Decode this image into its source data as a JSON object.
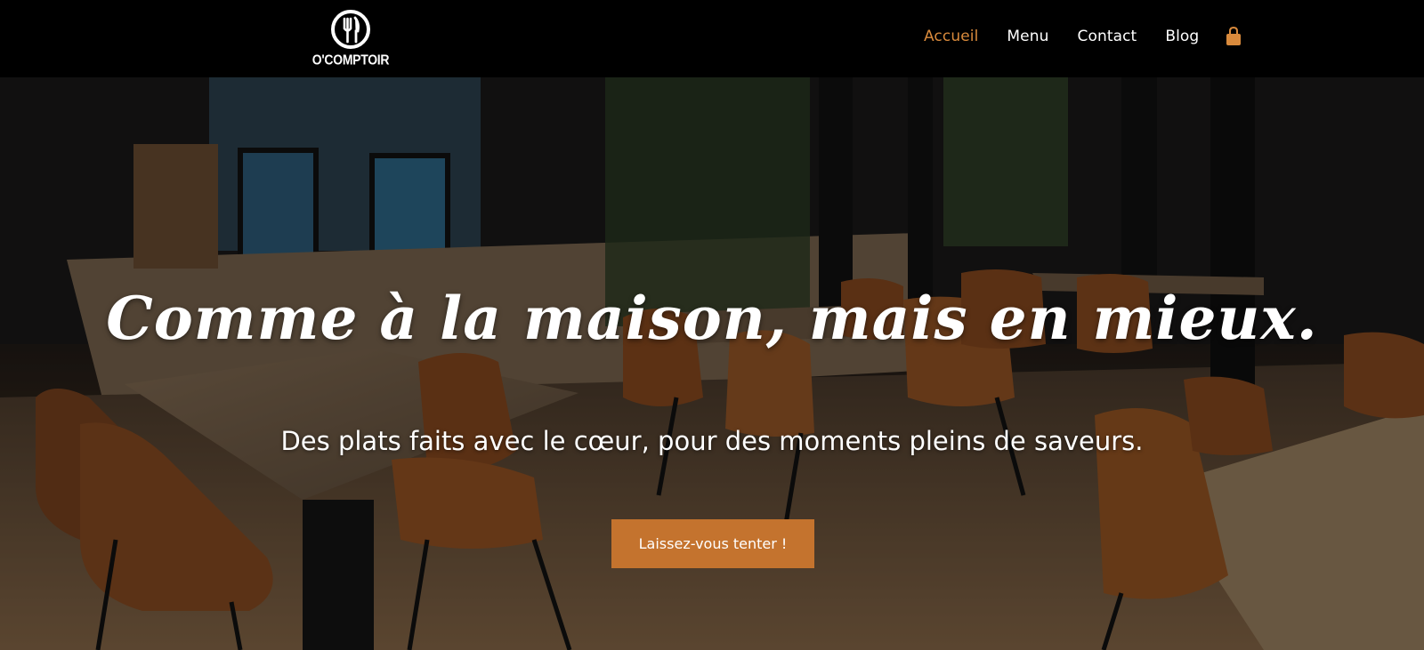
{
  "header": {
    "logo_text": "O'COMPTOIR",
    "nav": [
      {
        "label": "Accueil",
        "active": true
      },
      {
        "label": "Menu",
        "active": false
      },
      {
        "label": "Contact",
        "active": false
      },
      {
        "label": "Blog",
        "active": false
      }
    ],
    "cart_icon": "shopping-bag-icon"
  },
  "hero": {
    "title": "Comme à la maison, mais en mieux.",
    "subtitle": "Des plats faits avec le cœur, pour des moments pleins de saveurs.",
    "cta_label": "Laissez-vous tenter !"
  },
  "colors": {
    "accent": "#c4732e",
    "nav_active": "#d98a3c",
    "header_bg": "#000000"
  }
}
